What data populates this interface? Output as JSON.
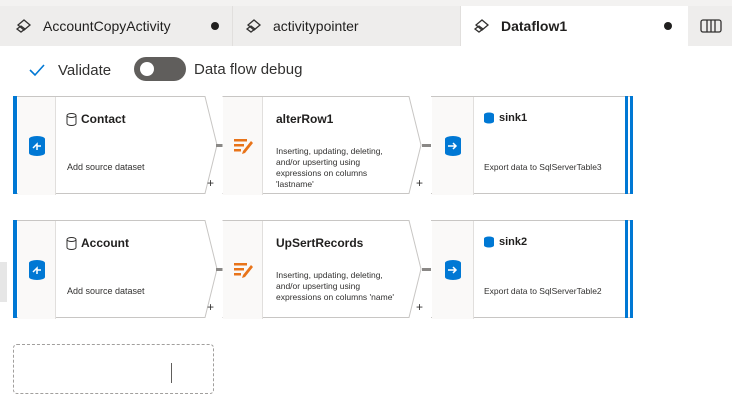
{
  "tabs": [
    {
      "label": "AccountCopyActivity",
      "unsaved": true,
      "icon": "pipeline-icon"
    },
    {
      "label": "activitypointer",
      "unsaved": false,
      "icon": "pipeline-icon"
    },
    {
      "label": "Dataflow1",
      "unsaved": true,
      "active": true,
      "icon": "dataflow-icon"
    }
  ],
  "toolbar": {
    "validate_label": "Validate",
    "debug_label": "Data flow debug",
    "debug_on": false
  },
  "flows": [
    {
      "source": {
        "title": "Contact",
        "desc": "Add source dataset"
      },
      "transform": {
        "title": "alterRow1",
        "desc": "Inserting, updating, deleting, and/or upserting using expressions on columns 'lastname'"
      },
      "sink": {
        "title": "sink1",
        "desc": "Export data to SqlServerTable3"
      }
    },
    {
      "source": {
        "title": "Account",
        "desc": "Add source dataset"
      },
      "transform": {
        "title": "UpSertRecords",
        "desc": "Inserting, updating, deleting, and/or upserting using expressions on columns 'name'"
      },
      "sink": {
        "title": "sink2",
        "desc": "Export data to SqlServerTable2"
      }
    }
  ],
  "plus_label": "+",
  "colors": {
    "accent": "#0078d4",
    "transform": "#e8741a",
    "toolbar_check": "#0078d4"
  }
}
